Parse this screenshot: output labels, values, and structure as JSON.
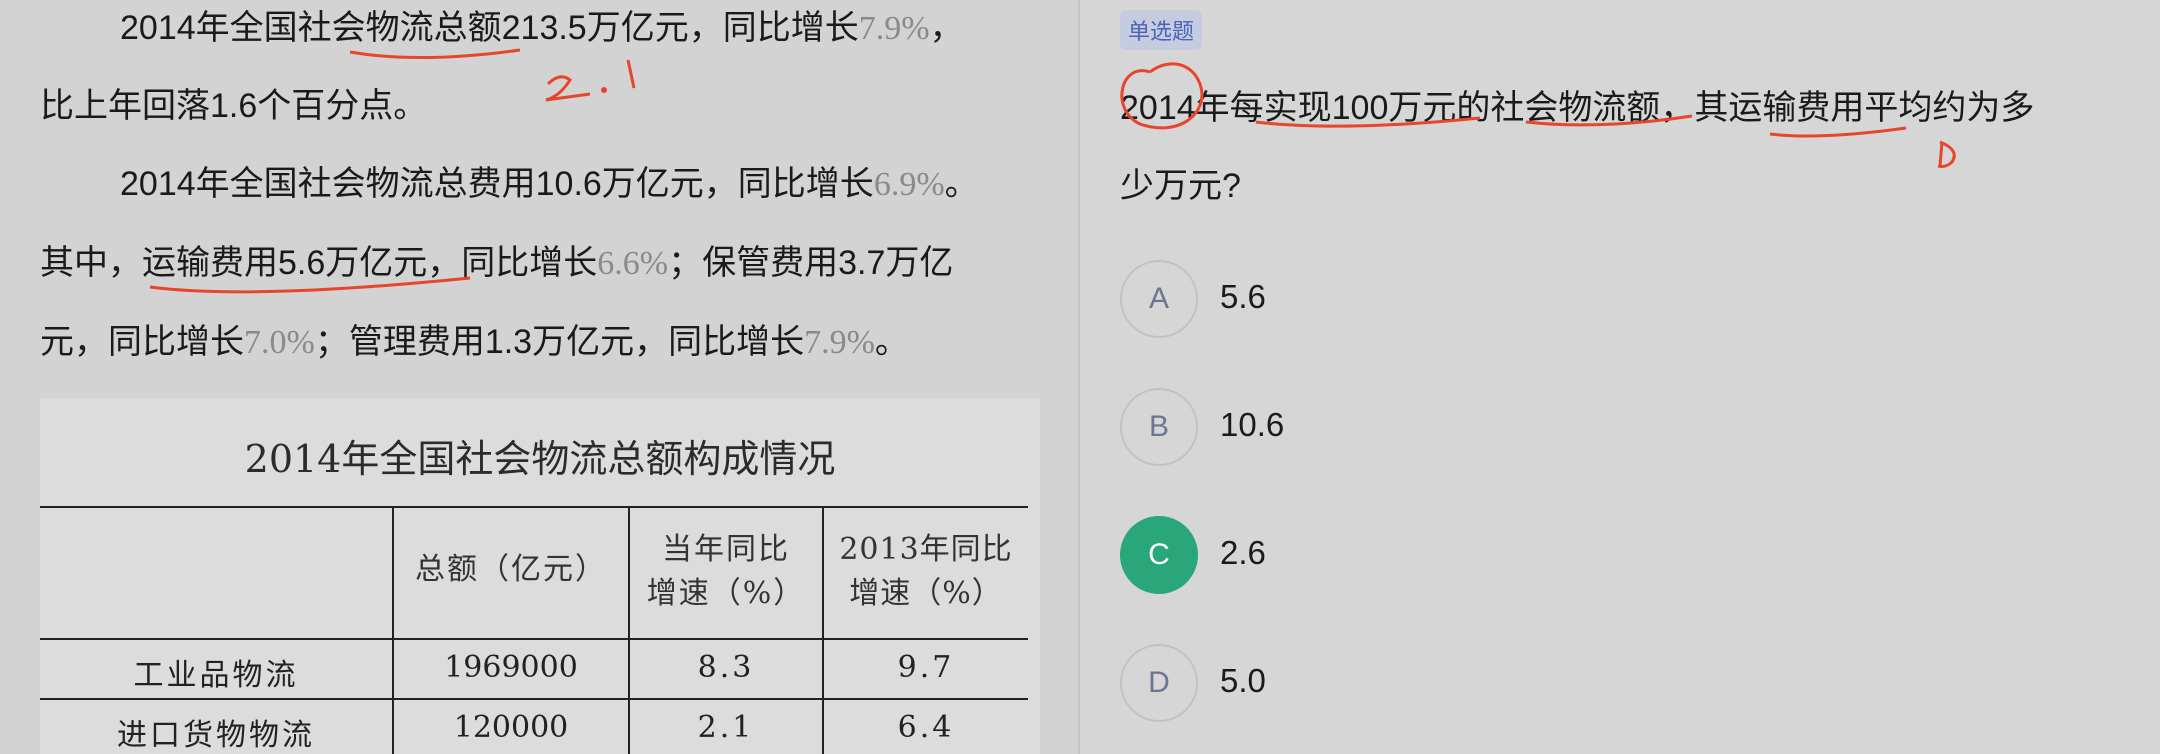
{
  "passage": {
    "p1_l1_a": "2014年全国社会物流总额213.5万亿元，同比增长",
    "p1_l1_pct": "7.9%",
    "p1_l1_end": "，",
    "p1_l2": "比上年回落1.6个百分点。",
    "p2_l1_a": "2014年全国社会物流总费用10.6万亿元，同比增长",
    "p2_l1_pct": "6.9%",
    "p2_l1_end": "。",
    "p2_l2_a": "其中，运输费用5.6万亿元，同比增长",
    "p2_l2_pct": "6.6%",
    "p2_l2_end": "；保管费用3.7万亿",
    "p2_l3_a": "元，同比增长",
    "p2_l3_pct1": "7.0%",
    "p2_l3_mid": "；管理费用1.3万亿元，同比增长",
    "p2_l3_pct2": "7.9%",
    "p2_l3_end": "。"
  },
  "annotation_text": "2.1",
  "table": {
    "title": "2014年全国社会物流总额构成情况",
    "headers": [
      "",
      "总额（亿元）",
      "当年同比增速（%）",
      "2013年同比增速（%）"
    ],
    "header_lines": {
      "h2a": "当年同比",
      "h2b": "增速（%）",
      "h3a": "2013年同比",
      "h3b": "增速（%）"
    },
    "rows": [
      {
        "name": "工业品物流",
        "total": "1969000",
        "growth": "8.3",
        "prev": "9.7"
      },
      {
        "name": "进口货物物流",
        "total": "120000",
        "growth": "2.1",
        "prev": "6.4"
      }
    ]
  },
  "question": {
    "tag": "单选题",
    "line1": "2014年每实现100万元的社会物流额，其运输费用平均约为多",
    "line2": "少万元?",
    "options": [
      {
        "letter": "A",
        "value": "5.6"
      },
      {
        "letter": "B",
        "value": "10.6"
      },
      {
        "letter": "C",
        "value": "2.6",
        "selected": true
      },
      {
        "letter": "D",
        "value": "5.0"
      }
    ]
  },
  "colors": {
    "selected": "#29a77b",
    "tag_bg": "#c6ccdf",
    "tag_text": "#4a63b8",
    "annotation": "#e8452c"
  }
}
